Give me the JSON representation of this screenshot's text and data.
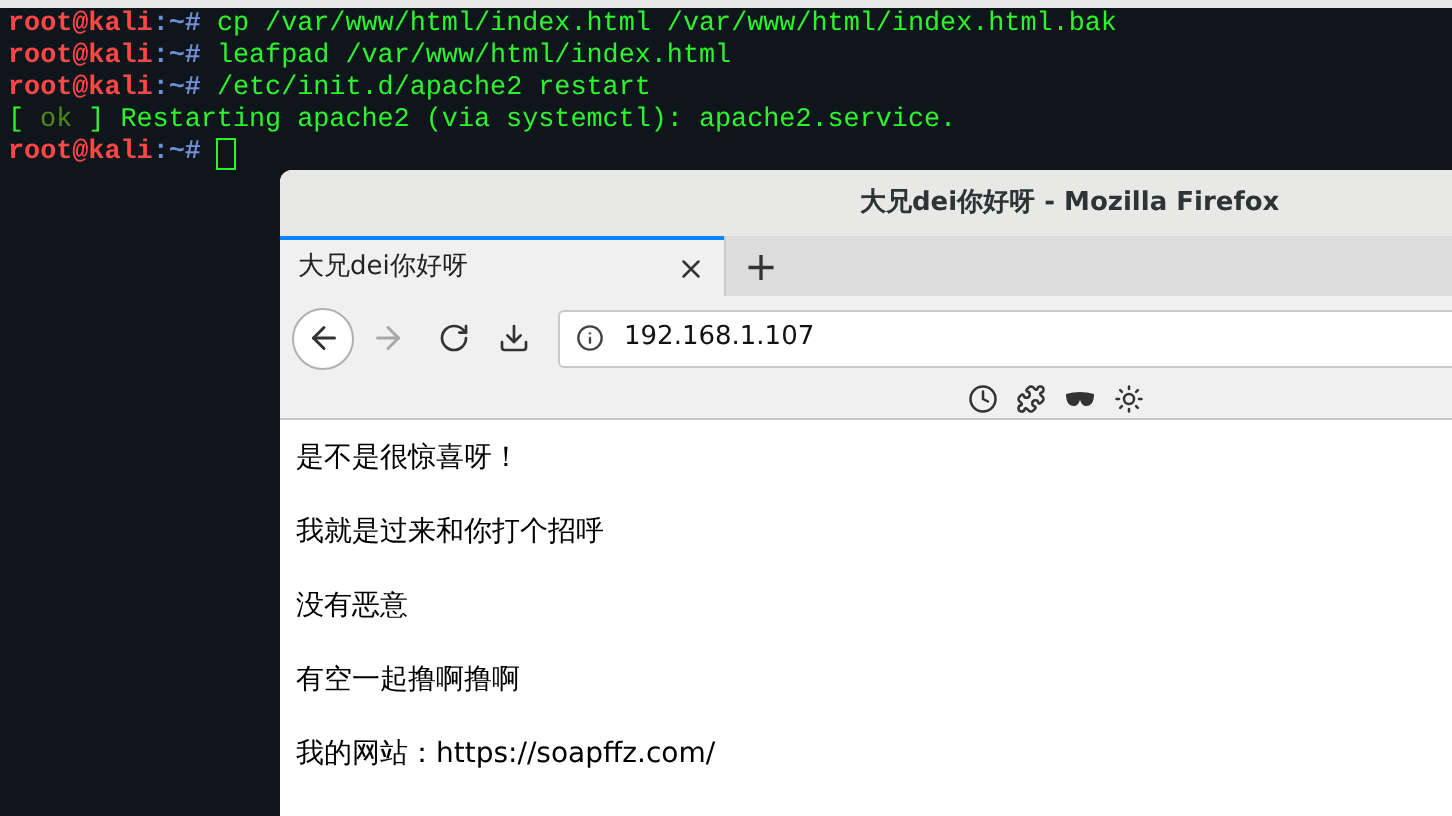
{
  "terminal": {
    "lines": [
      {
        "kind": "prompt",
        "prompt": "root@kali",
        "path": ":~#",
        "command": "cp /var/www/html/index.html /var/www/html/index.html.bak"
      },
      {
        "kind": "prompt",
        "prompt": "root@kali",
        "path": ":~#",
        "command": "leafpad /var/www/html/index.html"
      },
      {
        "kind": "prompt",
        "prompt": "root@kali",
        "path": ":~#",
        "command": "/etc/init.d/apache2 restart"
      },
      {
        "kind": "status",
        "open": "[",
        "status": "ok",
        "text": "] Restarting apache2 (via systemctl): apache2.service."
      },
      {
        "kind": "prompt",
        "prompt": "root@kali",
        "path": ":~#",
        "cursor": true
      }
    ]
  },
  "browser": {
    "window": {
      "title": "大兄dei你好呀 - Mozilla Firefox"
    },
    "tabs": [
      {
        "label": "大兄dei你好呀",
        "selected": true
      }
    ],
    "new_tab": "+",
    "url": "192.168.1.107",
    "page": {
      "paragraphs": [
        "是不是很惊喜呀！",
        "我就是过来和你打个招呼",
        "没有恶意",
        "有空一起撸啊撸啊",
        "我的网站：https://soapffz.com/"
      ]
    }
  }
}
